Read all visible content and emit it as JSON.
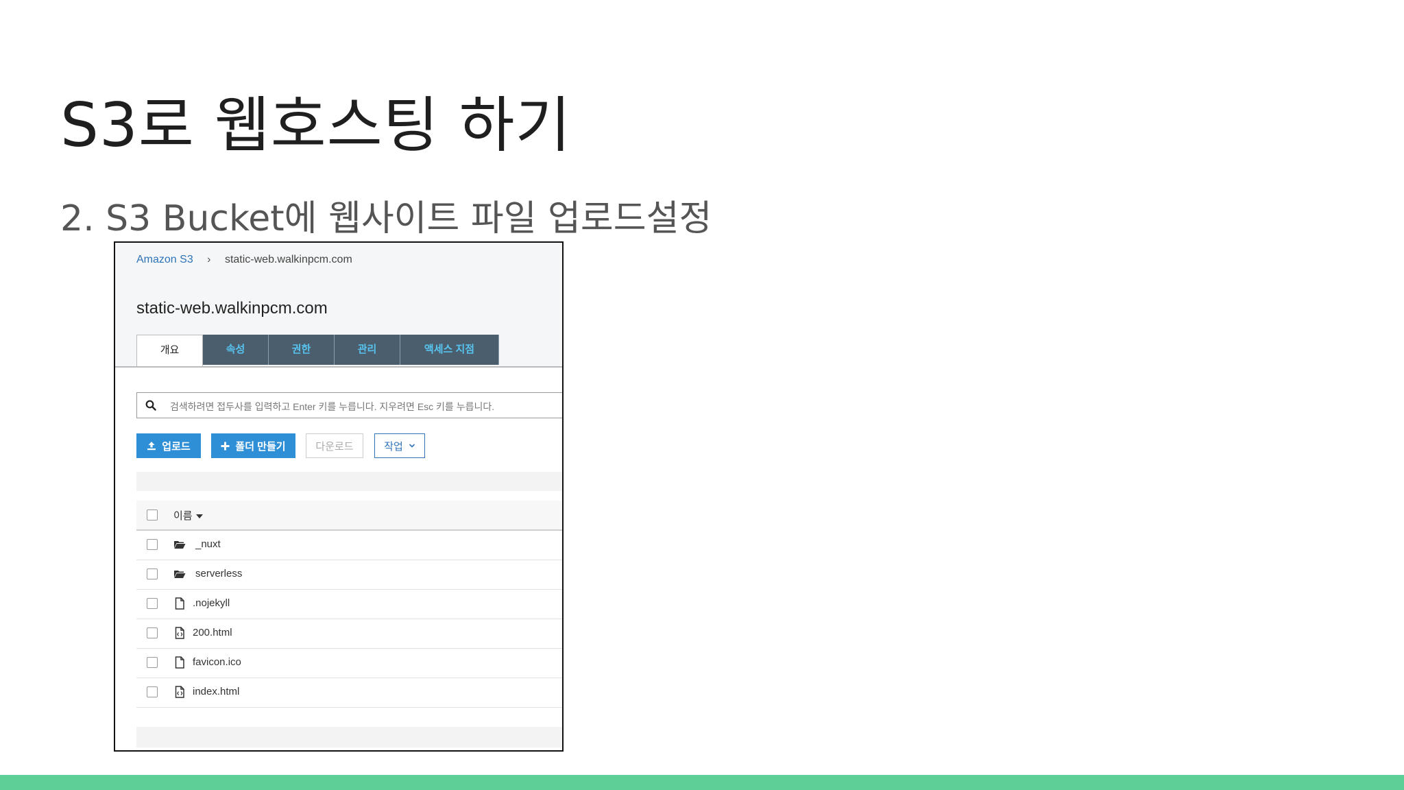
{
  "slide": {
    "title": "S3로 웹호스팅 하기",
    "subtitle": "2. S3 Bucket에 웹사이트 파일 업로드설정"
  },
  "console": {
    "breadcrumb": {
      "root": "Amazon S3",
      "separator": "›",
      "current": "static-web.walkinpcm.com"
    },
    "bucket_title": "static-web.walkinpcm.com",
    "tabs": [
      {
        "label": "개요",
        "active": true
      },
      {
        "label": "속성",
        "active": false
      },
      {
        "label": "권한",
        "active": false
      },
      {
        "label": "관리",
        "active": false
      },
      {
        "label": "액세스 지점",
        "active": false
      }
    ],
    "search": {
      "placeholder": "검색하려면 접두사를 입력하고 Enter 키를 누릅니다. 지우려면 Esc 키를 누릅니다."
    },
    "toolbar": {
      "upload": "업로드",
      "create_folder": "폴더 만들기",
      "download": "다운로드",
      "actions": "작업"
    },
    "table": {
      "name_header": "이름",
      "rows": [
        {
          "name": "_nuxt",
          "type": "folder"
        },
        {
          "name": "serverless",
          "type": "folder"
        },
        {
          "name": ".nojekyll",
          "type": "file"
        },
        {
          "name": "200.html",
          "type": "html"
        },
        {
          "name": "favicon.ico",
          "type": "file"
        },
        {
          "name": "index.html",
          "type": "html"
        }
      ]
    },
    "colors": {
      "tab_bg": "#4b5e6e",
      "tab_text": "#57c4ef",
      "primary": "#2e8fd6",
      "accent_bar": "#5dcf97"
    }
  }
}
